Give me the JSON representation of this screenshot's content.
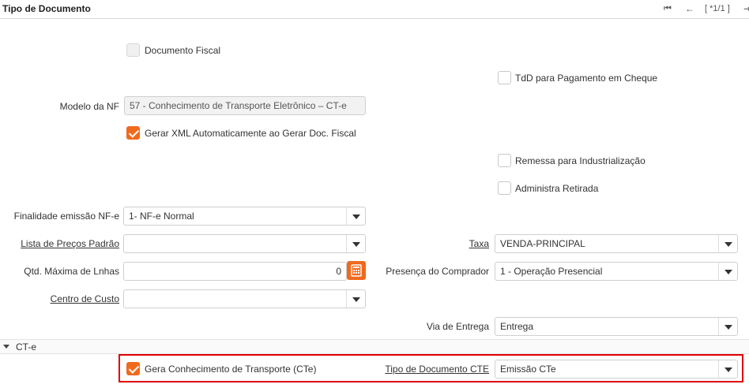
{
  "header": {
    "title": "Tipo de Documento",
    "nav_counter": "[ *1/1 ]",
    "first_icon": "first-record-icon",
    "prev_icon": "prev-record-icon",
    "next_icon": "next-record-icon"
  },
  "form": {
    "documento_fiscal": {
      "label": "Documento Fiscal",
      "checked": false,
      "disabled": true
    },
    "tdd_pagamento_cheque": {
      "label": "TdD para Pagamento em Cheque",
      "checked": false
    },
    "modelo_nf": {
      "label": "Modelo da NF",
      "value": "57 - Conhecimento de Transporte Eletrônico – CT-e"
    },
    "gerar_xml": {
      "label": "Gerar XML Automaticamente ao Gerar Doc. Fiscal",
      "checked": true
    },
    "remessa_industrializacao": {
      "label": "Remessa para Industrialização",
      "checked": false
    },
    "administra_retirada": {
      "label": "Administra Retirada",
      "checked": false
    },
    "finalidade_emissao": {
      "label": "Finalidade emissão NF-e",
      "value": "1- NF-e Normal"
    },
    "lista_precos_padrao": {
      "label": "Lista de Preços Padrão",
      "value": ""
    },
    "taxa": {
      "label": "Taxa",
      "value": "VENDA-PRINCIPAL"
    },
    "qtd_maxima_linhas": {
      "label": "Qtd. Máxima de Lnhas",
      "value": "0",
      "calc_icon": "calculator-icon"
    },
    "presenca_comprador": {
      "label": "Presença do Comprador",
      "value": "1 - Operação Presencial"
    },
    "centro_custo": {
      "label": "Centro de Custo",
      "value": ""
    },
    "via_entrega": {
      "label": "Via de Entrega",
      "value": "Entrega"
    }
  },
  "section_cte": {
    "title": "CT-e",
    "gera_cte": {
      "label": "Gera Conhecimento de Transporte (CTe)",
      "checked": true
    },
    "tipo_documento_cte": {
      "label": "Tipo de Documento CTE",
      "value": "Emissão CTe"
    }
  },
  "colors": {
    "accent": "#f06a1e",
    "highlight_border": "#e00000"
  }
}
